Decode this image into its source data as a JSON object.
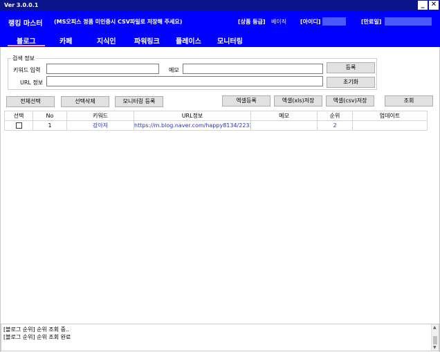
{
  "window": {
    "version": "Ver 3.0.0.1",
    "minimize": "_",
    "close": "✕"
  },
  "header": {
    "app_name": "랭킹 마스터",
    "notice": "(MS오피스 정품 미인증시 CSV파일로 저장해 주세요)",
    "grade_label": "[상품 등급]",
    "grade_value": "베이직",
    "id_label": "[아이디]",
    "expiry_label": "[만료일]",
    "tabs": [
      "블로그",
      "카페",
      "지식인",
      "파워링크",
      "플레이스",
      "모니터링"
    ]
  },
  "search": {
    "group_title": "검색 정보",
    "keyword_label": "키워드 입력",
    "memo_label": "메모",
    "url_label": "URL 정보",
    "keyword_value": "",
    "memo_value": "",
    "url_value": "",
    "register_button": "등록",
    "reset_button": "초기화"
  },
  "toolbar": {
    "select_all": "전체선택",
    "delete_selected": "선택삭제",
    "monitoring_register": "모니터링 등록",
    "excel_register": "엑셀등록",
    "excel_xls_save": "엑셀(xls)저장",
    "excel_csv_save": "엑셀(csv)저장",
    "lookup": "조회"
  },
  "table": {
    "columns": [
      "선택",
      "No",
      "키워드",
      "URL정보",
      "메모",
      "순위",
      "업데이트"
    ],
    "rows": [
      {
        "checked": false,
        "no": "1",
        "keyword": "강아지",
        "url": "https://m.blog.naver.com/happy8134/2233...",
        "memo": "",
        "rank": "2",
        "update": ""
      }
    ]
  },
  "log": {
    "lines": [
      "[블로그 순위] 순위 조회 중..",
      "[블로그 순위] 순위 조회 완료"
    ]
  },
  "colors": {
    "titlebar": "#0b148b",
    "header": "#0000ff",
    "tab_underline": "#ff9fb3",
    "link": "#2730c7"
  }
}
